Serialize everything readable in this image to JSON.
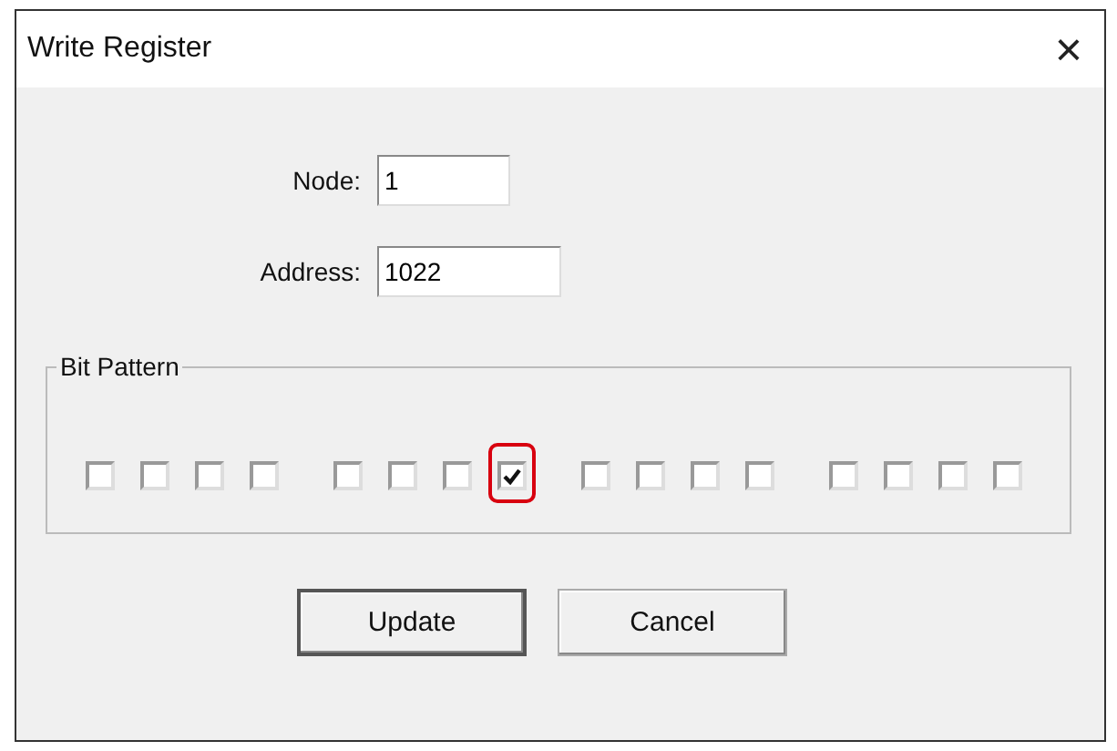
{
  "window": {
    "title": "Write Register",
    "close": "×"
  },
  "fields": [
    {
      "label": "Node:",
      "value": "1"
    },
    {
      "label": "Address:",
      "value": "1022"
    }
  ],
  "bit_pattern": {
    "title": "Bit Pattern",
    "groups": [
      [
        {
          "checked": false,
          "highlighted": false
        },
        {
          "checked": false,
          "highlighted": false
        },
        {
          "checked": false,
          "highlighted": false
        },
        {
          "checked": false,
          "highlighted": false
        }
      ],
      [
        {
          "checked": false,
          "highlighted": false
        },
        {
          "checked": false,
          "highlighted": false
        },
        {
          "checked": false,
          "highlighted": false
        },
        {
          "checked": true,
          "highlighted": true
        }
      ],
      [
        {
          "checked": false,
          "highlighted": false
        },
        {
          "checked": false,
          "highlighted": false
        },
        {
          "checked": false,
          "highlighted": false
        },
        {
          "checked": false,
          "highlighted": false
        }
      ],
      [
        {
          "checked": false,
          "highlighted": false
        },
        {
          "checked": false,
          "highlighted": false
        },
        {
          "checked": false,
          "highlighted": false
        },
        {
          "checked": false,
          "highlighted": false
        }
      ]
    ]
  },
  "buttons": [
    {
      "label": "Update",
      "default": true
    },
    {
      "label": "Cancel",
      "default": false
    }
  ]
}
